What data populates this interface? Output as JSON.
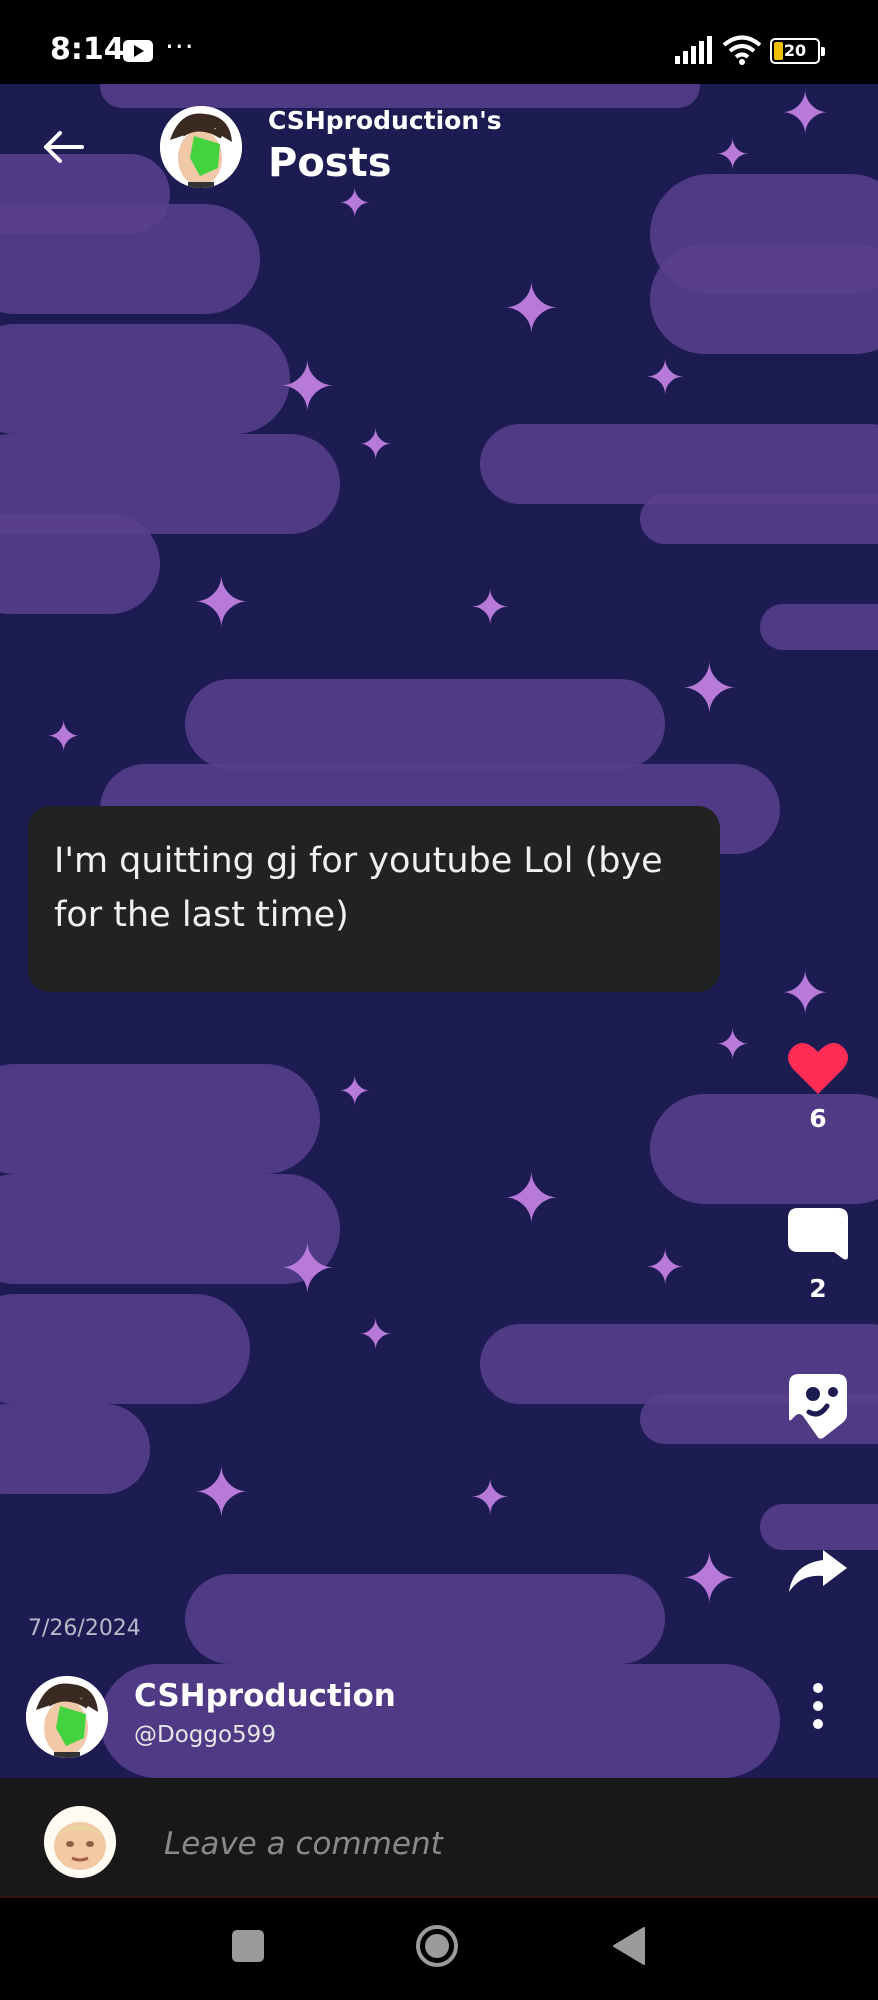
{
  "status_bar": {
    "time": "8:14",
    "dots": "···",
    "battery": "20"
  },
  "header": {
    "subtitle": "CSHproduction's",
    "title": "Posts"
  },
  "post": {
    "text": "I'm quitting gj for youtube Lol (bye for the last time)",
    "date": "7/26/2024",
    "likes": "6",
    "comments": "2",
    "liked_color": "#ff2d55"
  },
  "author": {
    "name": "CSHproduction",
    "handle": "@Doggo599"
  },
  "comment_bar": {
    "placeholder": "Leave a comment"
  },
  "icons": {
    "back": "arrow-left-icon",
    "like": "heart-icon",
    "comment": "speech-bubble-icon",
    "sticker": "sticker-icon",
    "share": "share-arrow-icon",
    "more": "vertical-dots-icon"
  }
}
